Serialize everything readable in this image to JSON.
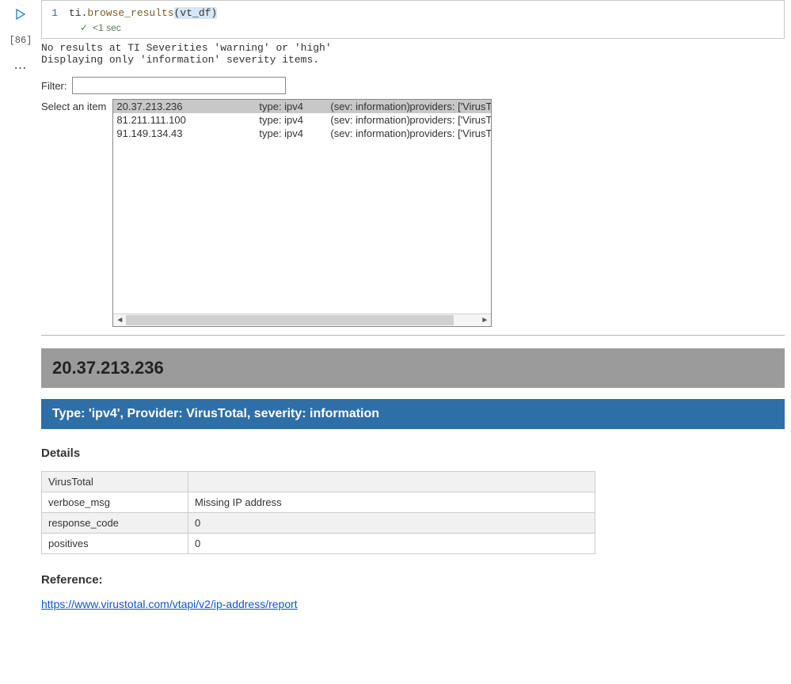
{
  "cell": {
    "exec_count_label": "[86]",
    "line_number": "1",
    "code_prefix": "ti.",
    "code_call": "browse_results",
    "code_arg": "(vt_df)",
    "status_time": "<1 sec"
  },
  "output": {
    "line1": "No results at TI Severities 'warning' or 'high'",
    "line2": "Displaying only 'information' severity items."
  },
  "filter": {
    "label": "Filter:",
    "value": ""
  },
  "select": {
    "label": "Select an item",
    "items": [
      {
        "ip": "20.37.213.236",
        "type": "type: ipv4",
        "sev": "(sev: information)",
        "prov": "providers: ['VirusTo",
        "selected": true
      },
      {
        "ip": "81.211.111.100",
        "type": "type: ipv4",
        "sev": "(sev: information)",
        "prov": "providers: ['VirusTo",
        "selected": false
      },
      {
        "ip": "91.149.134.43",
        "type": "type: ipv4",
        "sev": "(sev: information)",
        "prov": "providers: ['VirusTo",
        "selected": false
      }
    ]
  },
  "result": {
    "ip_header": "20.37.213.236",
    "type_bar": "Type: 'ipv4', Provider: VirusTotal, severity: information",
    "details_heading": "Details",
    "table": [
      {
        "k": "VirusTotal",
        "v": ""
      },
      {
        "k": "verbose_msg",
        "v": "Missing IP address"
      },
      {
        "k": "response_code",
        "v": "0"
      },
      {
        "k": "positives",
        "v": "0"
      }
    ],
    "reference_heading": "Reference:",
    "reference_url": "https://www.virustotal.com/vtapi/v2/ip-address/report"
  }
}
